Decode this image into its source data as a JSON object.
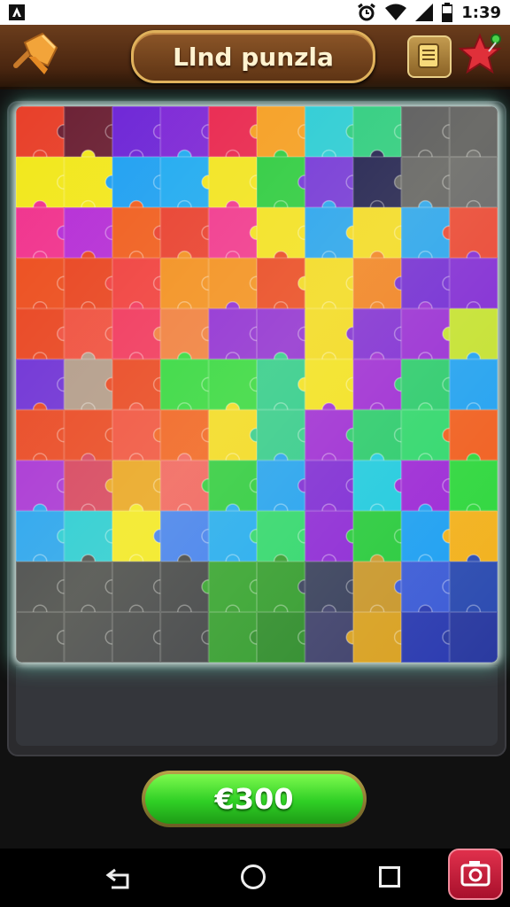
{
  "status_bar": {
    "time": "1:39",
    "icons": [
      "app-notification-icon",
      "alarm-icon",
      "wifi-icon",
      "signal-icon",
      "battery-icon"
    ]
  },
  "header": {
    "title": "Llnd punzla",
    "left_button_icon": "push-pin-icon",
    "right_buttons": [
      "notes-icon",
      "star-icon"
    ]
  },
  "puzzle": {
    "rows": 11,
    "cols": 10,
    "colors": [
      [
        "#e8402a",
        "#6a1f33",
        "#6b21d6",
        "#7a22d6",
        "#e81f4a",
        "#f59a1a",
        "#1ec9d6",
        "#1ec97a",
        "#4a4a52",
        "#4c4c54"
      ],
      [
        "#f2e71a",
        "#f2e71a",
        "#1a9ef2",
        "#1aa8f2",
        "#f2e31a",
        "#24c93a",
        "#6c2bd9",
        "#101048",
        "#55555c",
        "#5a5a61"
      ],
      [
        "#f0308c",
        "#b42ad6",
        "#f05a1a",
        "#e83a2a",
        "#f0308c",
        "#f2e01a",
        "#1a9ef2",
        "#f2d81a",
        "#1a9ef2",
        "#e83a2a"
      ],
      [
        "#ec4a1a",
        "#e8401c",
        "#f03a3a",
        "#f28c1a",
        "#f28c1a",
        "#e8401c",
        "#f2d81a",
        "#f07a1a",
        "#6a1fd6",
        "#7a1fd6"
      ],
      [
        "#e8401c",
        "#ef4a3a",
        "#f0305a",
        "#f07a3a",
        "#8a24d6",
        "#8a24d6",
        "#f2d81a",
        "#7a24d6",
        "#9424d6",
        "#c2e02a"
      ],
      [
        "#6a2ad6",
        "#b09888",
        "#e8401c",
        "#2ad63a",
        "#2ad63a",
        "#24c98a",
        "#f2e01a",
        "#9a24d6",
        "#24c96a",
        "#1a9ef2"
      ],
      [
        "#e8401c",
        "#e8401c",
        "#f04a3a",
        "#f05a1a",
        "#f2d81a",
        "#2ac98a",
        "#9a24d6",
        "#24c96a",
        "#2ad66a",
        "#f05a1a"
      ],
      [
        "#a42ad6",
        "#d43a5a",
        "#e8a01a",
        "#f05a5a",
        "#24c93a",
        "#1a9ef2",
        "#7a24d6",
        "#1ac9e0",
        "#9a24d6",
        "#2ad63a"
      ],
      [
        "#1a9ef2",
        "#1ac9d6",
        "#f2e71a",
        "#3a7af2",
        "#1aa8f2",
        "#2ad66a",
        "#8a24d6",
        "#24c93a",
        "#1a9ef2",
        "#f2b01a"
      ],
      [
        "#3a3c42",
        "#3e4046",
        "#3c3e44",
        "#3a3c42",
        "#2ea02a",
        "#2e9a2a",
        "#343c5a",
        "#c8962a",
        "#3a5ad6",
        "#2a4ab0"
      ],
      [
        "#3a3c42",
        "#3e4046",
        "#3c3e44",
        "#3a3c42",
        "#2e9a2a",
        "#2a8a28",
        "#3c3e6a",
        "#d8a020",
        "#2a3ab0",
        "#2a3aa0"
      ]
    ]
  },
  "action_button": {
    "label": "€300"
  },
  "nav_bar": {
    "buttons": [
      "back-icon",
      "home-icon",
      "recents-icon"
    ]
  },
  "screenshot_button": {
    "icon": "camera-icon"
  }
}
